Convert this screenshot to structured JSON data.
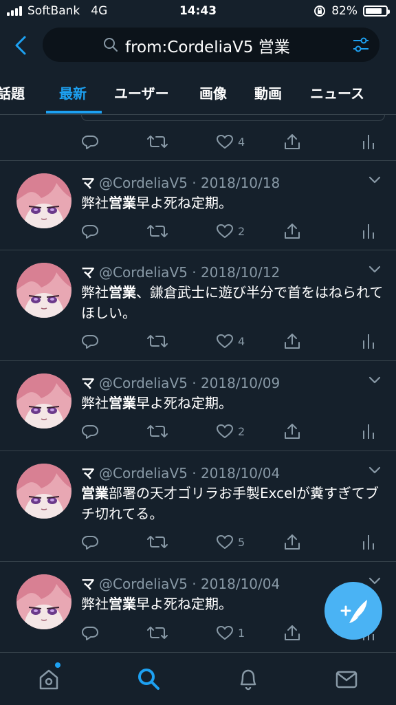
{
  "status_bar": {
    "carrier": "SoftBank",
    "network": "4G",
    "time": "14:43",
    "battery": "82%",
    "battery_level": 0.82
  },
  "search": {
    "query": "from:CordeliaV5 営業"
  },
  "tabs": [
    "話題",
    "最新",
    "ユーザー",
    "画像",
    "動画",
    "ニュース"
  ],
  "active_tab": "最新",
  "colors": {
    "background": "#15202b",
    "accent": "#1da1f2",
    "muted": "#8899a6",
    "divider": "#38444d",
    "fab": "#4ab3f4"
  },
  "previous_tweet": {
    "likes": "4"
  },
  "tweets": [
    {
      "name": "マ",
      "handle": "@CordeliaV5",
      "date": "2018/10/18",
      "text_before": "弊社",
      "text_bold": "営業",
      "text_after": "早よ死ね定期。",
      "likes": "2"
    },
    {
      "name": "マ",
      "handle": "@CordeliaV5",
      "date": "2018/10/12",
      "text_before": "弊社",
      "text_bold": "営業",
      "text_after": "、鎌倉武士に遊び半分で首をはねられてほしい。",
      "likes": "4"
    },
    {
      "name": "マ",
      "handle": "@CordeliaV5",
      "date": "2018/10/09",
      "text_before": "弊社",
      "text_bold": "営業",
      "text_after": "早よ死ね定期。",
      "likes": "2"
    },
    {
      "name": "マ",
      "handle": "@CordeliaV5",
      "date": "2018/10/04",
      "text_before": "",
      "text_bold": "営業",
      "text_after": "部署の天才ゴリラお手製Excelが糞すぎてブチ切れてる。",
      "likes": "5"
    },
    {
      "name": "マ",
      "handle": "@CordeliaV5",
      "date": "2018/10/04",
      "text_before": "弊社",
      "text_bold": "営業",
      "text_after": "早よ死ね定期。",
      "likes": "1"
    }
  ],
  "icons": {
    "back": "chevron-left-icon",
    "search": "search-icon",
    "filter": "filter-sliders-icon",
    "reply": "reply-icon",
    "retweet": "retweet-icon",
    "like": "heart-icon",
    "share": "share-icon",
    "analytics": "analytics-icon",
    "caret": "chevron-down-icon",
    "compose": "compose-feather-icon",
    "nav": [
      "home-icon",
      "search-icon",
      "notifications-bell-icon",
      "messages-envelope-icon"
    ]
  }
}
